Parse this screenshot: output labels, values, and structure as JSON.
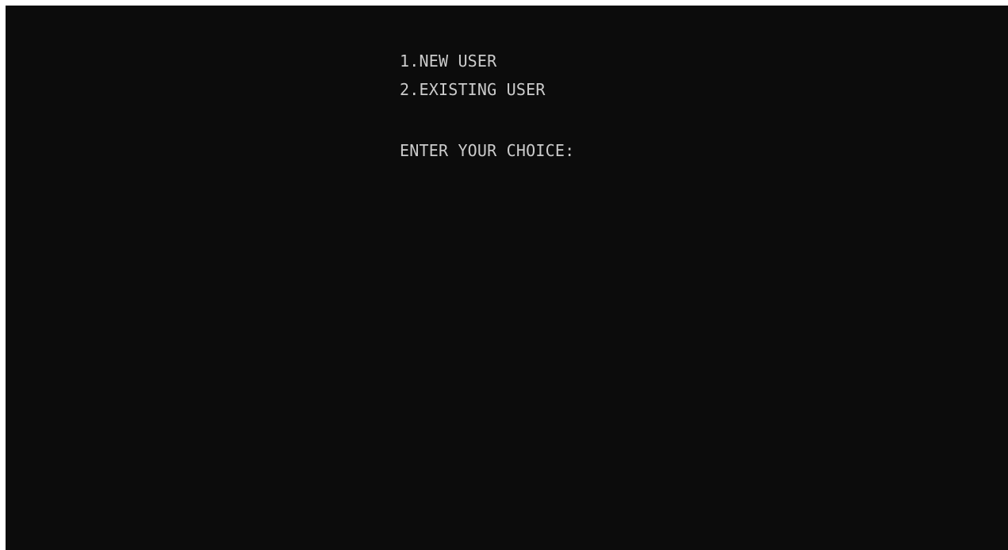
{
  "console": {
    "background": "#0c0c0c",
    "text_color": "#cccccc",
    "menu": [
      {
        "label": "1.NEW USER"
      },
      {
        "label": "2.EXISTING USER"
      }
    ],
    "prompt": "ENTER YOUR CHOICE:"
  }
}
